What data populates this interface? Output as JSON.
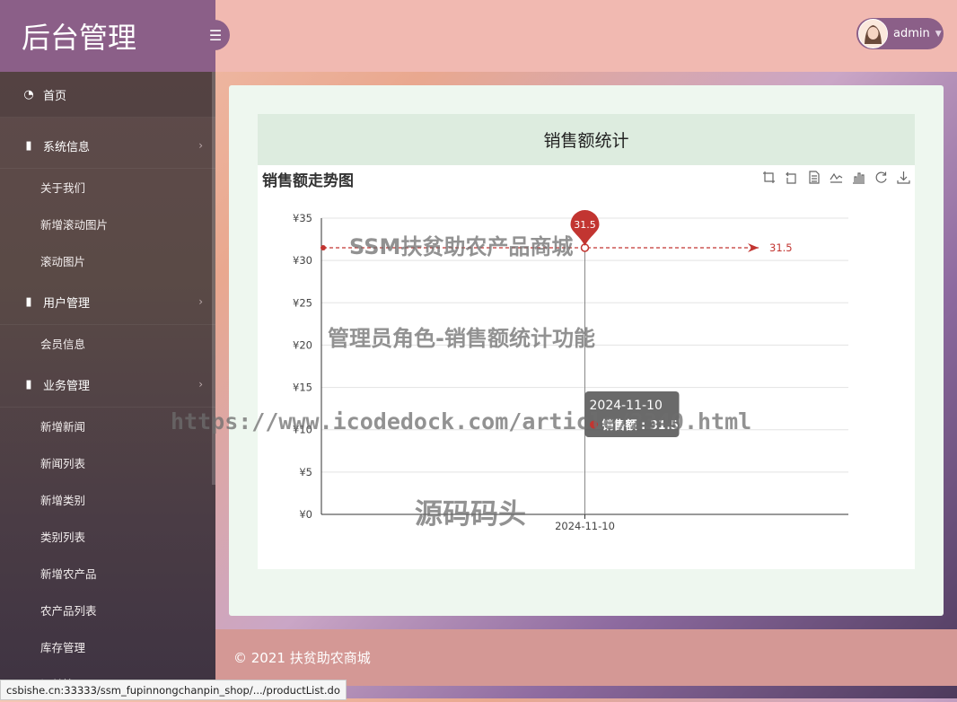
{
  "brand": "后台管理",
  "sidebar": {
    "home": "首页",
    "groups": [
      {
        "label": "系统信息",
        "items": [
          "关于我们",
          "新增滚动图片",
          "滚动图片"
        ]
      },
      {
        "label": "用户管理",
        "items": [
          "会员信息"
        ]
      },
      {
        "label": "业务管理",
        "items": [
          "新增新闻",
          "新闻列表",
          "新增类别",
          "类别列表",
          "新增农产品",
          "农产品列表",
          "库存管理",
          "订单管理"
        ]
      }
    ]
  },
  "header": {
    "toggle_icon": "menu-icon",
    "username": "admin"
  },
  "panel": {
    "title": "销售额统计"
  },
  "chart_data": {
    "type": "line",
    "title": "销售额走势图",
    "categories": [
      "2024-11-10"
    ],
    "series": [
      {
        "name": "销售额",
        "values": [
          31.5
        ]
      }
    ],
    "yticks": [
      "¥35",
      "¥30",
      "¥25",
      "¥20",
      "¥15",
      "¥10",
      "¥5",
      "¥0"
    ],
    "ylim": [
      0,
      35
    ],
    "markpoint_label": "31.5",
    "markline_label": "31.5",
    "tooltip": {
      "title": "2024-11-10",
      "label": "销售额 : 31.5"
    },
    "colors": {
      "series": "#c23531"
    }
  },
  "toolbox": [
    "zoom-icon",
    "zoom-reset-icon",
    "data-view-icon",
    "line-icon",
    "bar-icon",
    "restore-icon",
    "download-icon"
  ],
  "footer": "© 2021 扶贫助农商城",
  "statusbar": "csbishe.cn:33333/ssm_fupinnongchanpin_shop/.../productList.do",
  "watermarks": [
    "SSM扶贫助农产品商城",
    "管理员角色-销售额统计功能",
    "https://www.icodedock.com/article/2340.html",
    "源码码头"
  ]
}
